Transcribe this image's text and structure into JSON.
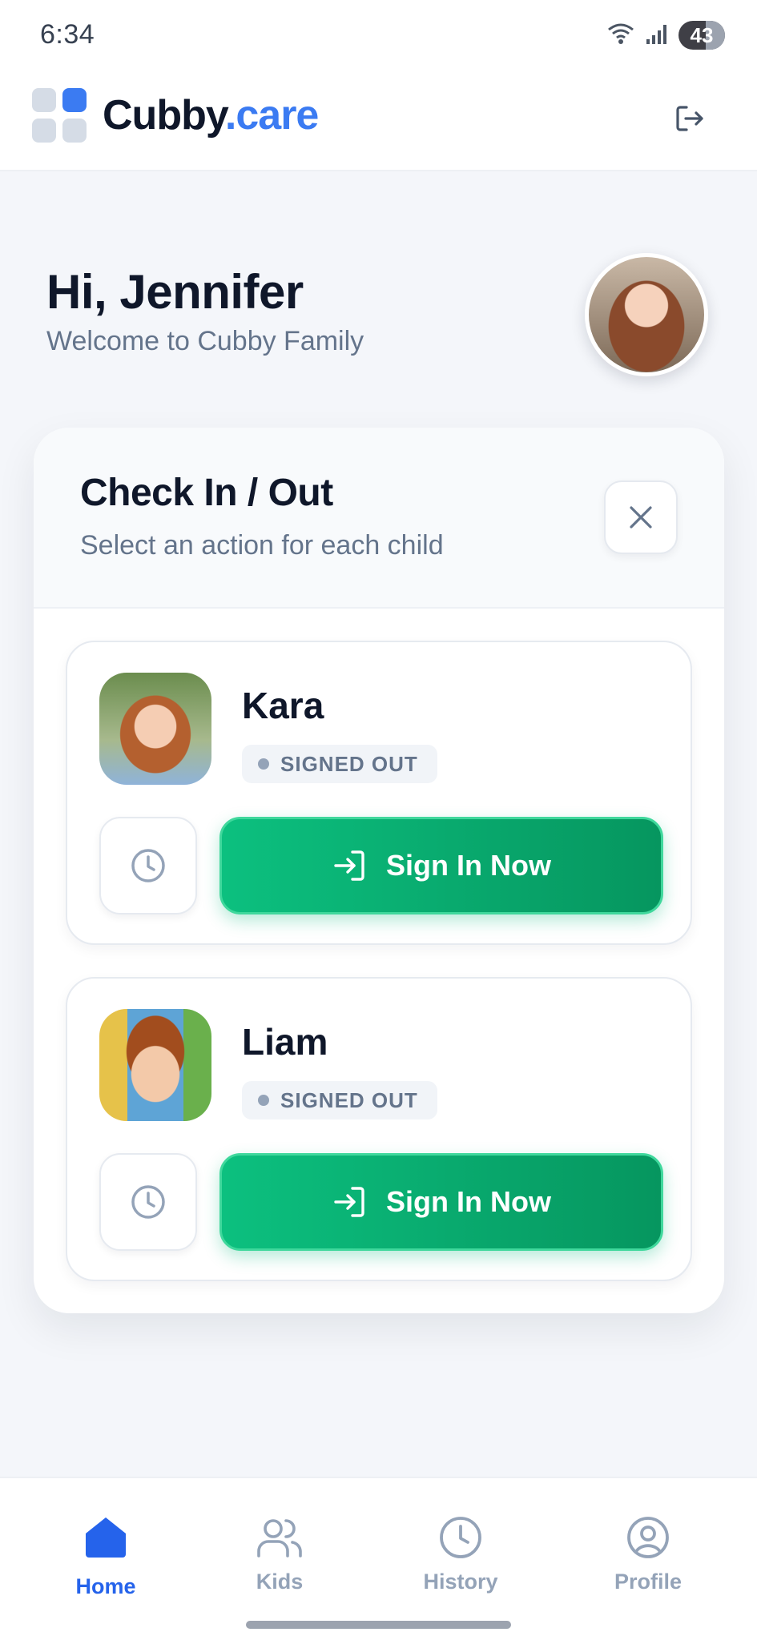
{
  "status_bar": {
    "time": "6:34",
    "battery": "43",
    "icons": [
      "wifi-icon",
      "signal-icon",
      "battery-icon"
    ]
  },
  "header": {
    "brand_main": "Cubby",
    "brand_suffix": ".care",
    "logout_icon": "logout-icon"
  },
  "greeting": {
    "title": "Hi, Jennifer",
    "subtitle": "Welcome to Cubby Family"
  },
  "panel": {
    "title": "Check In / Out",
    "subtitle": "Select an action for each child",
    "close_icon": "close-icon"
  },
  "children": [
    {
      "name": "Kara",
      "status": "SIGNED OUT",
      "action_label": "Sign In Now"
    },
    {
      "name": "Liam",
      "status": "SIGNED OUT",
      "action_label": "Sign In Now"
    }
  ],
  "nav": {
    "items": [
      {
        "label": "Home",
        "icon": "home-icon",
        "active": true
      },
      {
        "label": "Kids",
        "icon": "users-icon",
        "active": false
      },
      {
        "label": "History",
        "icon": "clock-icon",
        "active": false
      },
      {
        "label": "Profile",
        "icon": "profile-icon",
        "active": false
      }
    ]
  },
  "colors": {
    "brand_blue": "#3b7bf2",
    "action_green": "#0cc07f",
    "status_gray": "#94a3b8",
    "nav_active": "#2563eb"
  }
}
